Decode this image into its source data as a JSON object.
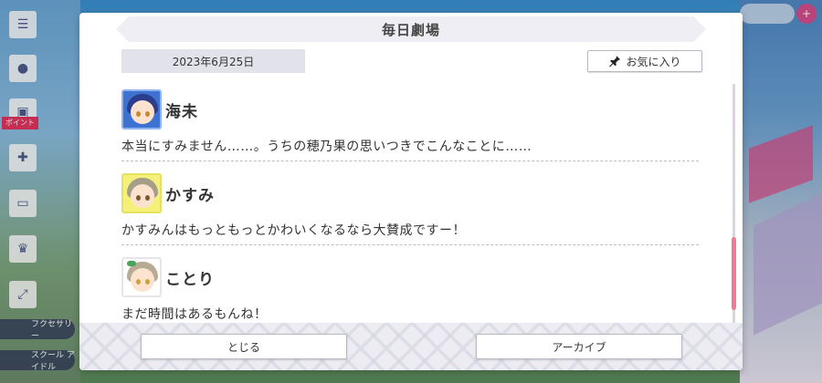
{
  "background": {
    "side_badge": "ポイント",
    "side_labels": [
      "フクセサリー",
      "スクール アイドル"
    ]
  },
  "dialog": {
    "title": "毎日劇場",
    "date": "2023年6月25日",
    "favorite_label": "お気に入り",
    "entries": [
      {
        "name": "海未",
        "text": "本当にすみません……。うちの穂乃果の思いつきでこんなことに……"
      },
      {
        "name": "かすみ",
        "text": "かすみんはもっともっとかわいくなるなら大賛成ですー！"
      },
      {
        "name": "ことり",
        "text": "まだ時間はあるもんね！"
      }
    ],
    "close_label": "とじる",
    "archive_label": "アーカイブ"
  },
  "colors": {
    "scroll_thumb": "#f07a96",
    "umi_frame": "#3e72d0",
    "kasumi_frame": "#f4f07a"
  }
}
